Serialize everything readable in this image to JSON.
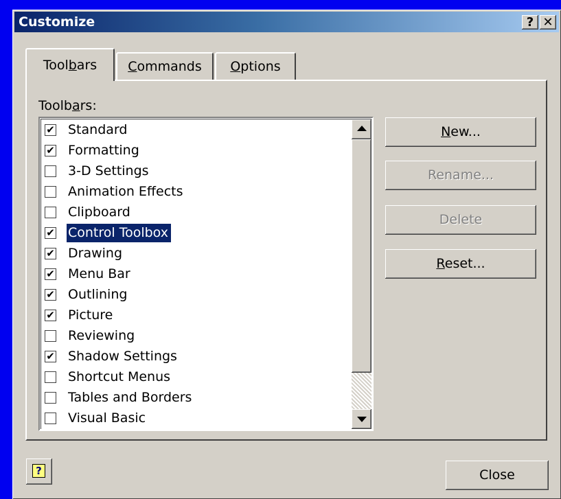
{
  "window": {
    "title": "Customize",
    "help_button": "?",
    "close_button": "✕"
  },
  "tabs": [
    {
      "pre": "Tool",
      "key": "b",
      "post": "ars"
    },
    {
      "pre": "",
      "key": "C",
      "post": "ommands"
    },
    {
      "pre": "",
      "key": "O",
      "post": "ptions"
    }
  ],
  "toolbars_label": {
    "pre": "Toolb",
    "key": "a",
    "post": "rs:"
  },
  "toolbars": [
    {
      "label": "Standard",
      "checked": true
    },
    {
      "label": "Formatting",
      "checked": true
    },
    {
      "label": "3-D Settings",
      "checked": false
    },
    {
      "label": "Animation Effects",
      "checked": false
    },
    {
      "label": "Clipboard",
      "checked": false
    },
    {
      "label": "Control Toolbox",
      "checked": true,
      "selected": true
    },
    {
      "label": "Drawing",
      "checked": true
    },
    {
      "label": "Menu Bar",
      "checked": true
    },
    {
      "label": "Outlining",
      "checked": true
    },
    {
      "label": "Picture",
      "checked": true
    },
    {
      "label": "Reviewing",
      "checked": false
    },
    {
      "label": "Shadow Settings",
      "checked": true
    },
    {
      "label": "Shortcut Menus",
      "checked": false
    },
    {
      "label": "Tables and Borders",
      "checked": false
    },
    {
      "label": "Visual Basic",
      "checked": false
    }
  ],
  "buttons": {
    "new": {
      "key": "N",
      "post": "ew..."
    },
    "rename": "Rename...",
    "delete": "Delete",
    "reset": {
      "key": "R",
      "post": "eset..."
    },
    "close": "Close"
  },
  "check_glyph": "✔",
  "help_icon_glyph": "?",
  "colors": {
    "desktop": "#0000f0",
    "dialog_face": "#d4d0c8",
    "title_start": "#0a246a",
    "title_end": "#a6caf0",
    "selection": "#0a246a"
  }
}
